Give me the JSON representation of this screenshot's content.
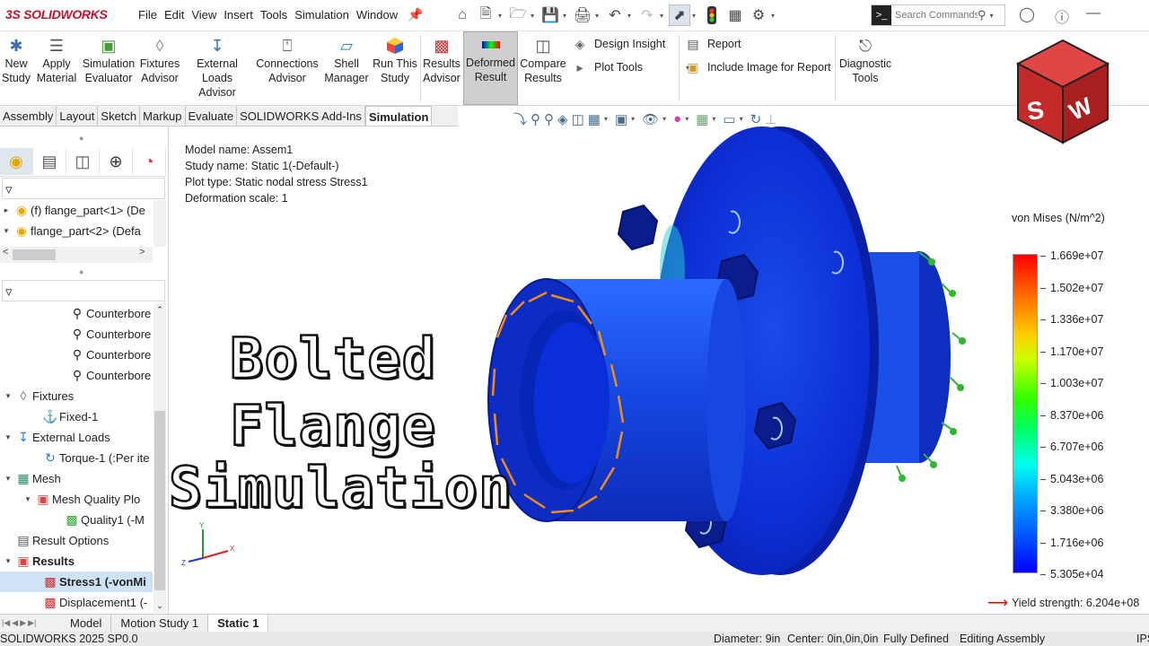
{
  "app": {
    "brand": "SOLIDWORKS",
    "brand_mark": "3S"
  },
  "menu": [
    "File",
    "Edit",
    "View",
    "Insert",
    "Tools",
    "Simulation",
    "Window"
  ],
  "search": {
    "placeholder": "Search Commands"
  },
  "ribbon": {
    "buttons": [
      {
        "label1": "New",
        "label2": "Study",
        "icon": "new-study-icon"
      },
      {
        "label1": "Apply",
        "label2": "Material",
        "icon": "apply-material-icon"
      },
      {
        "label1": "Simulation",
        "label2": "Evaluator",
        "icon": "simulation-evaluator-icon"
      },
      {
        "label1": "Fixtures",
        "label2": "Advisor",
        "icon": "fixtures-advisor-icon"
      },
      {
        "label1": "External",
        "label2": "Loads Advisor",
        "icon": "external-loads-icon"
      },
      {
        "label1": "Connections",
        "label2": "Advisor",
        "icon": "connections-advisor-icon"
      },
      {
        "label1": "Shell",
        "label2": "Manager",
        "icon": "shell-manager-icon"
      },
      {
        "label1": "Run This",
        "label2": "Study",
        "icon": "run-study-icon"
      },
      {
        "label1": "Results",
        "label2": "Advisor",
        "icon": "results-advisor-icon"
      },
      {
        "label1": "Deformed",
        "label2": "Result",
        "icon": "deformed-result-icon"
      },
      {
        "label1": "Compare",
        "label2": "Results",
        "icon": "compare-results-icon"
      }
    ],
    "design_insight": "Design Insight",
    "plot_tools": "Plot Tools",
    "report": "Report",
    "include_image": "Include Image for Report",
    "diagnostic1": "Diagnostic",
    "diagnostic2": "Tools"
  },
  "tabs": [
    "Assembly",
    "Layout",
    "Sketch",
    "Markup",
    "Evaluate",
    "SOLIDWORKS Add-Ins",
    "Simulation"
  ],
  "active_tab": "Simulation",
  "feature_tree": {
    "items": [
      {
        "label": "(f) flange_part<1> (De"
      },
      {
        "label": "flange_part<2> (Defa"
      }
    ]
  },
  "study_tree": {
    "counterbores": [
      "Counterbore",
      "Counterbore",
      "Counterbore",
      "Counterbore"
    ],
    "fixtures": "Fixtures",
    "fixed": "Fixed-1",
    "external_loads": "External Loads",
    "torque": "Torque-1 (:Per ite",
    "mesh": "Mesh",
    "mesh_quality": "Mesh Quality Plo",
    "quality": "Quality1 (-M",
    "result_options": "Result Options",
    "results": "Results",
    "stress": "Stress1 (-vonMi",
    "displacement": "Displacement1 (-"
  },
  "plot_info": {
    "model": "Model name: Assem1",
    "study": "Study name: Static 1(-Default-)",
    "plot_type": "Plot type: Static nodal stress Stress1",
    "scale": "Deformation scale: 1"
  },
  "overlay_title": [
    "Bolted",
    "Flange",
    "Simulation"
  ],
  "legend": {
    "title": "von Mises (N/m^2)",
    "values": [
      "1.669e+07",
      "1.502e+07",
      "1.336e+07",
      "1.170e+07",
      "1.003e+07",
      "8.370e+06",
      "6.707e+06",
      "5.043e+06",
      "3.380e+06",
      "1.716e+06",
      "5.305e+04"
    ],
    "yield": "Yield strength: 6.204e+08"
  },
  "bottom_tabs": [
    "Model",
    "Motion Study 1",
    "Static 1"
  ],
  "status": {
    "version": "SOLIDWORKS 2025 SP0.0",
    "diameter": "Diameter: 9in",
    "center": "Center: 0in,0in,0in",
    "defined": "Fully Defined",
    "mode": "Editing Assembly",
    "units": "IPS"
  }
}
